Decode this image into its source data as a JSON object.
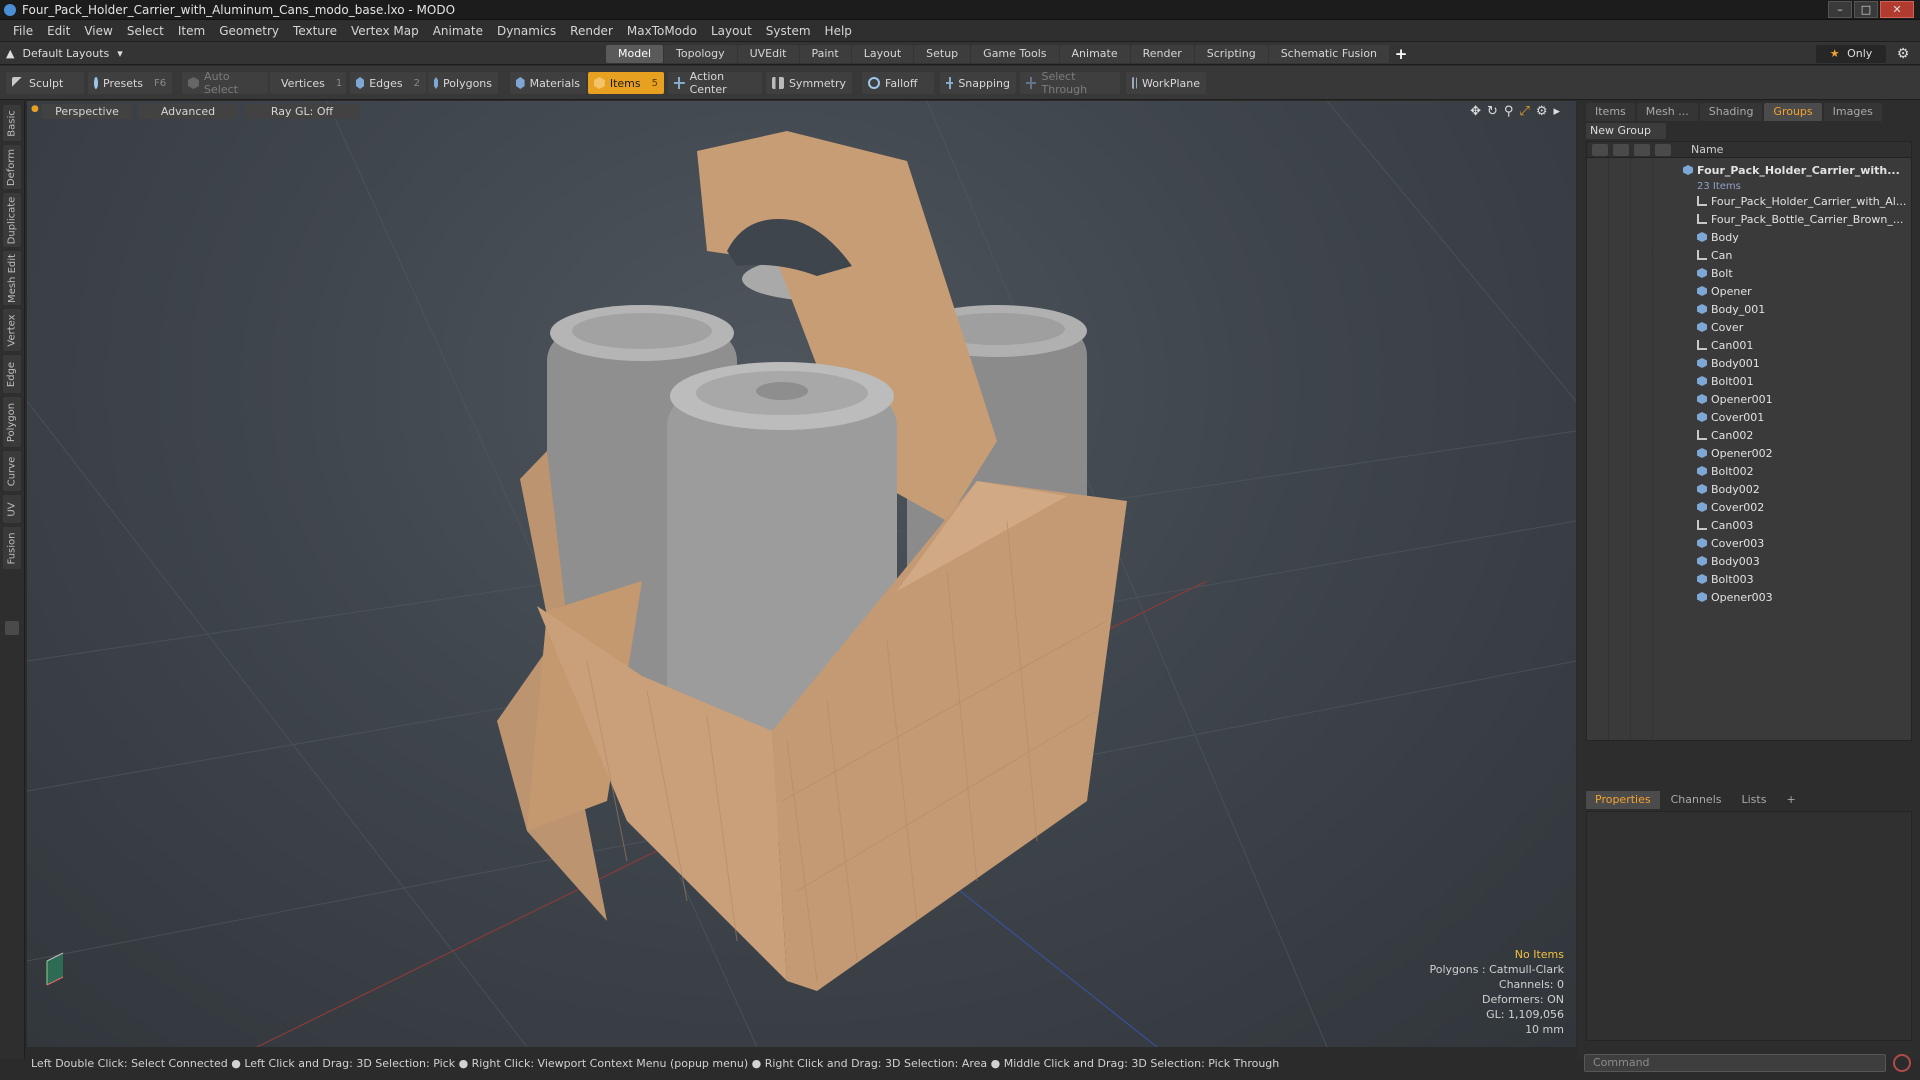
{
  "window": {
    "title": "Four_Pack_Holder_Carrier_with_Aluminum_Cans_modo_base.lxo - MODO"
  },
  "menu": [
    "File",
    "Edit",
    "View",
    "Select",
    "Item",
    "Geometry",
    "Texture",
    "Vertex Map",
    "Animate",
    "Dynamics",
    "Render",
    "MaxToModo",
    "Layout",
    "System",
    "Help"
  ],
  "layout": {
    "selector": "Default Layouts",
    "tabs": [
      "Model",
      "Topology",
      "UVEdit",
      "Paint",
      "Layout",
      "Setup",
      "Game Tools",
      "Animate",
      "Render",
      "Scripting",
      "Schematic Fusion"
    ],
    "active_tab": "Model",
    "only_label": "Only"
  },
  "toolbar": {
    "sculpt": "Sculpt",
    "presets": "Presets",
    "presets_key": "F6",
    "auto_select": "Auto Select",
    "vertices": "Vertices",
    "vertices_count": "1",
    "edges": "Edges",
    "edges_count": "2",
    "polygons": "Polygons",
    "materials": "Materials",
    "items": "Items",
    "items_count": "5",
    "action_center": "Action Center",
    "symmetry": "Symmetry",
    "falloff": "Falloff",
    "snapping": "Snapping",
    "select_through": "Select Through",
    "workplane": "WorkPlane"
  },
  "left_tabs": [
    "Basic",
    "Deform",
    "Duplicate",
    "Mesh Edit",
    "Vertex",
    "Edge",
    "Polygon",
    "Curve",
    "UV",
    "Fusion"
  ],
  "viewport": {
    "view": "Perspective",
    "mode": "Advanced",
    "raygl": "Ray GL: Off",
    "stats": {
      "selection": "No Items",
      "polygons": "Polygons : Catmull-Clark",
      "channels": "Channels: 0",
      "deformers": "Deformers: ON",
      "gl": "GL: 1,109,056",
      "scale": "10 mm"
    }
  },
  "right_panel": {
    "tabs": [
      "Items",
      "Mesh ...",
      "Shading",
      "Groups",
      "Images"
    ],
    "active_tab": "Groups",
    "new_group": "New Group",
    "name_header": "Name",
    "root": {
      "name": "Four_Pack_Holder_Carrier_with...",
      "count": "23 Items"
    },
    "items": [
      {
        "name": "Four_Pack_Holder_Carrier_with_Al...",
        "type": "locator"
      },
      {
        "name": "Four_Pack_Bottle_Carrier_Brown_...",
        "type": "locator"
      },
      {
        "name": "Body",
        "type": "mesh"
      },
      {
        "name": "Can",
        "type": "locator"
      },
      {
        "name": "Bolt",
        "type": "mesh"
      },
      {
        "name": "Opener",
        "type": "mesh"
      },
      {
        "name": "Body_001",
        "type": "mesh"
      },
      {
        "name": "Cover",
        "type": "mesh"
      },
      {
        "name": "Can001",
        "type": "locator"
      },
      {
        "name": "Body001",
        "type": "mesh"
      },
      {
        "name": "Bolt001",
        "type": "mesh"
      },
      {
        "name": "Opener001",
        "type": "mesh"
      },
      {
        "name": "Cover001",
        "type": "mesh"
      },
      {
        "name": "Can002",
        "type": "locator"
      },
      {
        "name": "Opener002",
        "type": "mesh"
      },
      {
        "name": "Bolt002",
        "type": "mesh"
      },
      {
        "name": "Body002",
        "type": "mesh"
      },
      {
        "name": "Cover002",
        "type": "mesh"
      },
      {
        "name": "Can003",
        "type": "locator"
      },
      {
        "name": "Cover003",
        "type": "mesh"
      },
      {
        "name": "Body003",
        "type": "mesh"
      },
      {
        "name": "Bolt003",
        "type": "mesh"
      },
      {
        "name": "Opener003",
        "type": "mesh"
      }
    ],
    "props_tabs": [
      "Properties",
      "Channels",
      "Lists"
    ],
    "props_active": "Properties",
    "command_placeholder": "Command"
  },
  "status": "Left Double Click: Select Connected ● Left Click and Drag: 3D Selection: Pick ● Right Click: Viewport Context Menu (popup menu) ● Right Click and Drag: 3D Selection: Area ● Middle Click and Drag: 3D Selection: Pick Through",
  "colors": {
    "accent": "#e8a020",
    "carton": "#c9a07a",
    "can": "#9a9a9a"
  }
}
